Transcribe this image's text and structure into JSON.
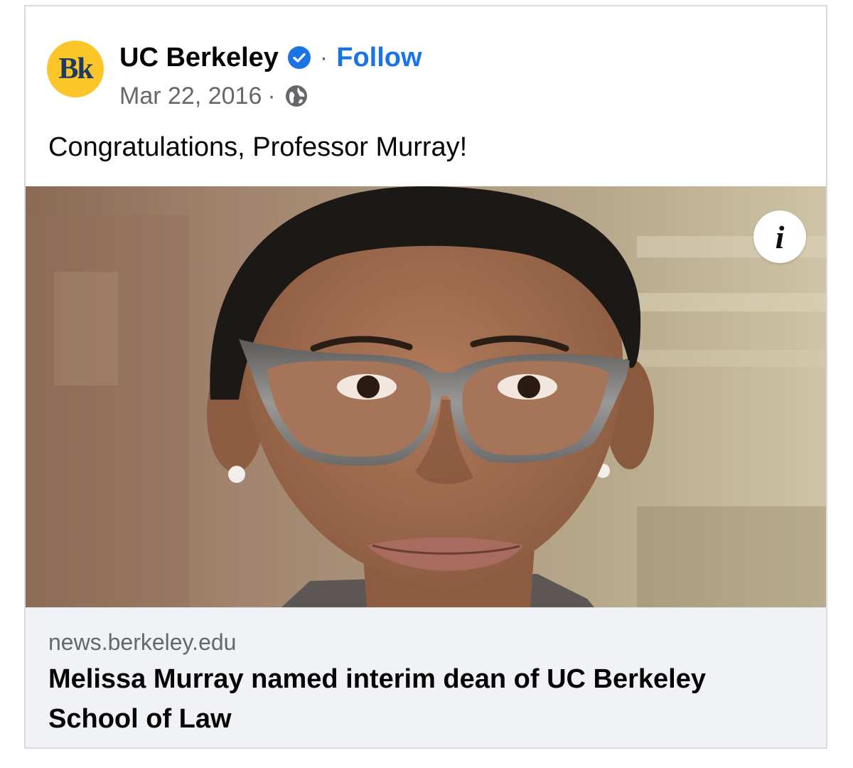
{
  "post": {
    "author": {
      "avatar_text": "Bk",
      "name": "UC Berkeley",
      "verified_icon": "verified-badge-icon",
      "follow_label": "Follow",
      "separator": "·"
    },
    "date": "Mar 22, 2016",
    "audience_icon": "globe-icon",
    "text": "Congratulations, Professor Murray!",
    "image": {
      "description_icon": "info-icon",
      "info_glyph": "i"
    },
    "link": {
      "domain": "news.berkeley.edu",
      "headline": "Melissa Murray named interim dean of UC Berkeley School of Law"
    }
  },
  "colors": {
    "accent": "#1b74e4",
    "avatar_bg": "#fcc629",
    "avatar_text": "#1f3a63",
    "muted": "#65676b",
    "preview_bg": "#f0f2f5"
  }
}
